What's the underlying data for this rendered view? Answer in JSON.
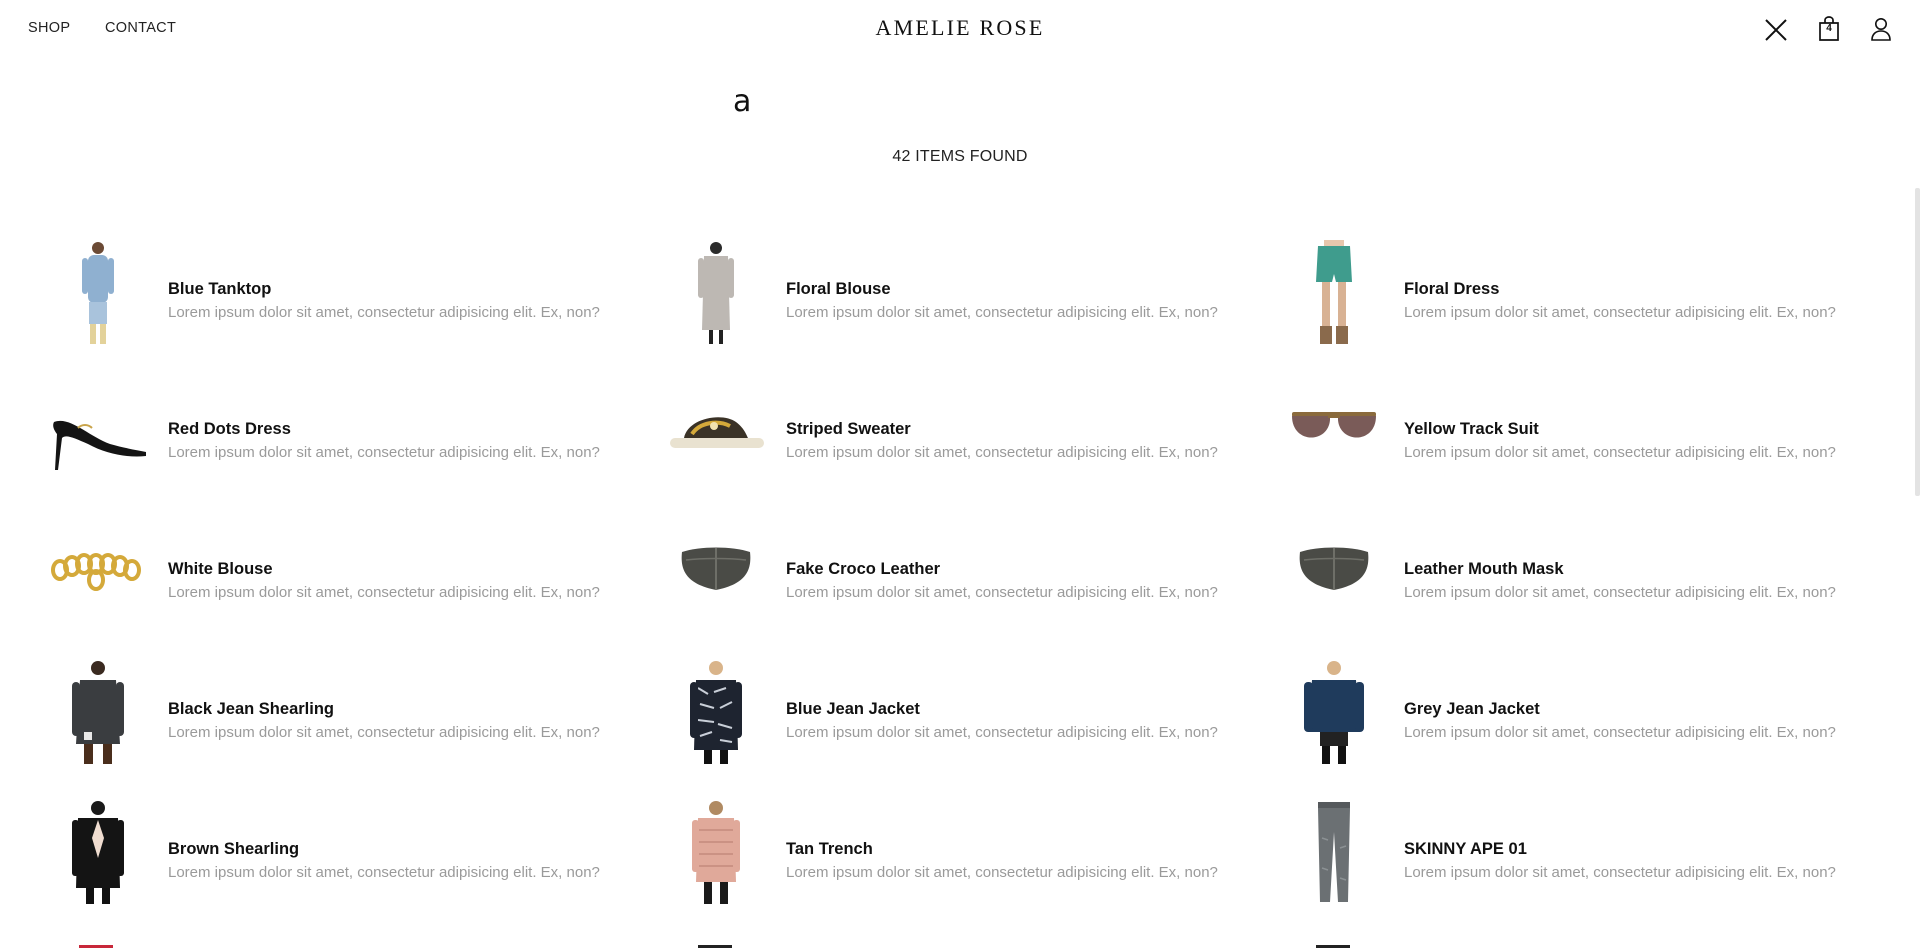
{
  "header": {
    "nav": {
      "shop": "SHOP",
      "contact": "CONTACT"
    },
    "logo": "AMELIE ROSE",
    "cart_count": "4"
  },
  "search": {
    "query": "a",
    "results_count_text": "42 ITEMS FOUND"
  },
  "results": [
    {
      "name": "Blue Tanktop",
      "desc": "Lorem ipsum dolor sit amet, consectetur adipisicing elit. Ex, non?",
      "thumb": "model-blue-denim-dress"
    },
    {
      "name": "Floral Blouse",
      "desc": "Lorem ipsum dolor sit amet, consectetur adipisicing elit. Ex, non?",
      "thumb": "model-grey-long-dress"
    },
    {
      "name": "Floral Dress",
      "desc": "Lorem ipsum dolor sit amet, consectetur adipisicing elit. Ex, non?",
      "thumb": "model-teal-shorts"
    },
    {
      "name": "Red Dots Dress",
      "desc": "Lorem ipsum dolor sit amet, consectetur adipisicing elit. Ex, non?",
      "thumb": "black-stiletto-heel"
    },
    {
      "name": "Striped Sweater",
      "desc": "Lorem ipsum dolor sit amet, consectetur adipisicing elit. Ex, non?",
      "thumb": "printed-slide-sandal"
    },
    {
      "name": "Yellow Track Suit",
      "desc": "Lorem ipsum dolor sit amet, consectetur adipisicing elit. Ex, non?",
      "thumb": "aviator-sunglasses"
    },
    {
      "name": "White Blouse",
      "desc": "Lorem ipsum dolor sit amet, consectetur adipisicing elit. Ex, non?",
      "thumb": "gold-chain-bracelet"
    },
    {
      "name": "Fake Croco Leather",
      "desc": "Lorem ipsum dolor sit amet, consectetur adipisicing elit. Ex, non?",
      "thumb": "leather-face-mask"
    },
    {
      "name": "Leather Mouth Mask",
      "desc": "Lorem ipsum dolor sit amet, consectetur adipisicing elit. Ex, non?",
      "thumb": "leather-face-mask"
    },
    {
      "name": "Black Jean Shearling",
      "desc": "Lorem ipsum dolor sit amet, consectetur adipisicing elit. Ex, non?",
      "thumb": "model-dark-quilted-jacket"
    },
    {
      "name": "Blue Jean Jacket",
      "desc": "Lorem ipsum dolor sit amet, consectetur adipisicing elit. Ex, non?",
      "thumb": "model-patterned-jacket"
    },
    {
      "name": "Grey Jean Jacket",
      "desc": "Lorem ipsum dolor sit amet, consectetur adipisicing elit. Ex, non?",
      "thumb": "model-navy-jacket"
    },
    {
      "name": "Brown Shearling",
      "desc": "Lorem ipsum dolor sit amet, consectetur adipisicing elit. Ex, non?",
      "thumb": "model-black-blazer"
    },
    {
      "name": "Tan Trench",
      "desc": "Lorem ipsum dolor sit amet, consectetur adipisicing elit. Ex, non?",
      "thumb": "model-pink-puffer"
    },
    {
      "name": "SKINNY APE 01",
      "desc": "Lorem ipsum dolor sit amet, consectetur adipisicing elit. Ex, non?",
      "thumb": "grey-skinny-jeans"
    }
  ],
  "colors": {
    "text": "#111111",
    "muted": "#9a9a9a",
    "denim": "#8fb0d0",
    "grey_knit": "#bdb8b3",
    "teal": "#3f9c8d",
    "black": "#141414",
    "gold": "#d4a93a",
    "navy": "#1f3b5c",
    "pink": "#e0a99a",
    "charcoal": "#3a3d40",
    "lens": "#7a5b58"
  }
}
